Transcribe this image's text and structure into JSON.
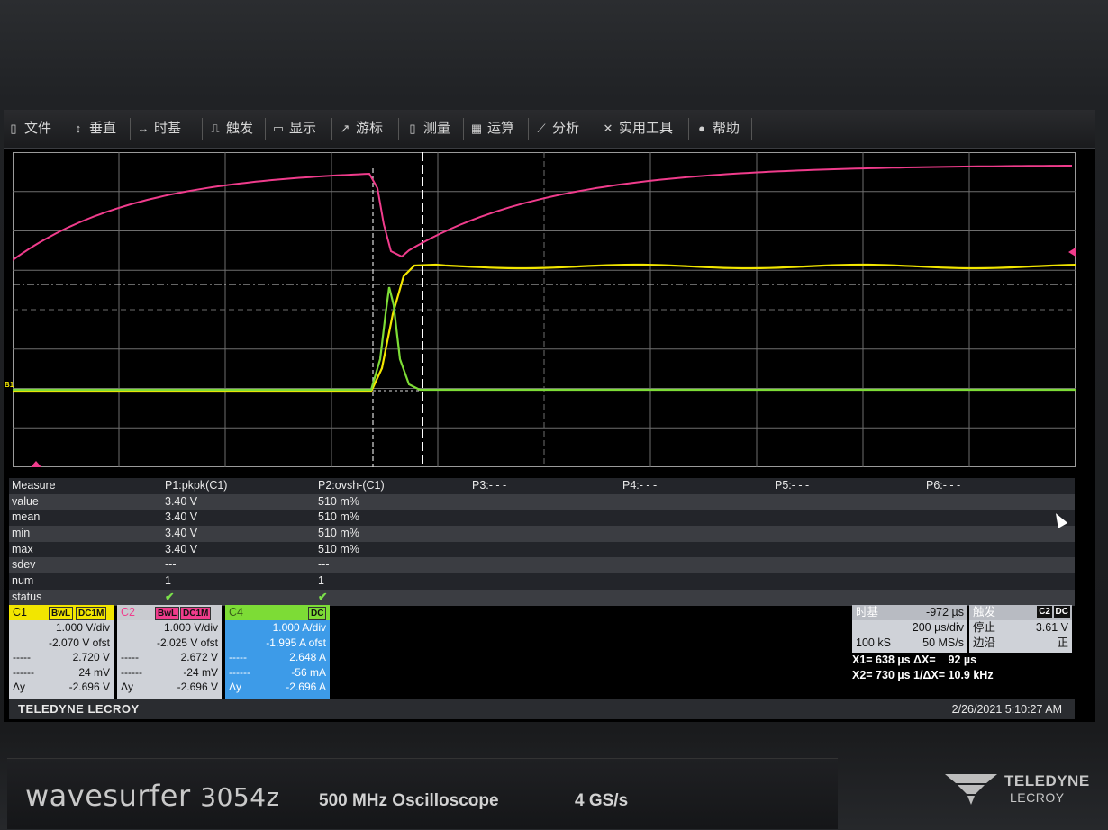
{
  "menu": [
    {
      "icon": "folder-icon",
      "glyph": "▯",
      "label": "文件"
    },
    {
      "icon": "vertical-icon",
      "glyph": "↕",
      "label": "垂直"
    },
    {
      "icon": "horizontal-icon",
      "glyph": "↔",
      "label": "时基"
    },
    {
      "icon": "trigger-icon",
      "glyph": "⎍",
      "label": "触发"
    },
    {
      "icon": "display-icon",
      "glyph": "▭",
      "label": "显示"
    },
    {
      "icon": "cursor-icon",
      "glyph": "↗",
      "label": "游标"
    },
    {
      "icon": "measure-icon",
      "glyph": "▯",
      "label": "测量"
    },
    {
      "icon": "math-icon",
      "glyph": "▦",
      "label": "运算"
    },
    {
      "icon": "analysis-icon",
      "glyph": "⟋",
      "label": "分析"
    },
    {
      "icon": "tools-icon",
      "glyph": "✕",
      "label": "实用工具"
    },
    {
      "icon": "help-icon",
      "glyph": "●",
      "label": "帮助"
    }
  ],
  "measure": {
    "header": {
      "label": "Measure",
      "p1": "P1:pkpk(C1)",
      "p2": "P2:ovsh-(C1)",
      "p3": "P3:- - -",
      "p4": "P4:- - -",
      "p5": "P5:- - -",
      "p6": "P6:- - -"
    },
    "rows": [
      {
        "label": "value",
        "p1": "3.40 V",
        "p2": "510 m%"
      },
      {
        "label": "mean",
        "p1": "3.40 V",
        "p2": "510 m%"
      },
      {
        "label": "min",
        "p1": "3.40 V",
        "p2": "510 m%"
      },
      {
        "label": "max",
        "p1": "3.40 V",
        "p2": "510 m%"
      },
      {
        "label": "sdev",
        "p1": "---",
        "p2": "---"
      },
      {
        "label": "num",
        "p1": "1",
        "p2": "1"
      },
      {
        "label": "status",
        "p1": "✔",
        "p2": "✔"
      }
    ]
  },
  "channels": [
    {
      "name": "C1",
      "color": "#f2e600",
      "tags": [
        "BwL",
        "DC1M"
      ],
      "vdiv": "1.000 V/div",
      "ofst": "-2.070 V ofst",
      "c1": "2.720 V",
      "c2": "24 mV",
      "dy_label": "Δy",
      "dy": "-2.696 V"
    },
    {
      "name": "C2",
      "color": "#f03c8c",
      "tags": [
        "BwL",
        "DC1M"
      ],
      "vdiv": "1.000 V/div",
      "ofst": "-2.025 V ofst",
      "c1": "2.672 V",
      "c2": "-24 mV",
      "dy_label": "Δy",
      "dy": "-2.696 V"
    },
    {
      "name": "C4",
      "color": "#7ddc36",
      "tags": [
        "DC"
      ],
      "vdiv": "1.000 A/div",
      "ofst": "-1.995 A ofst",
      "c1": "2.648 A",
      "c2": "-56 mA",
      "dy_label": "Δy",
      "dy": "-2.696 A"
    }
  ],
  "timebase": {
    "label": "时基",
    "delay": "-972 µs",
    "tdiv": "200 µs/div",
    "samples": "100 kS",
    "rate": "50 MS/s"
  },
  "trigger": {
    "label": "触发",
    "tags": [
      "C2",
      "DC"
    ],
    "mode": "停止",
    "level": "3.61 V",
    "edge_label": "边沿",
    "slope": "正"
  },
  "cursors": {
    "line1": "X1= 638 µs ΔX=    92 µs",
    "line2": "X2= 730 µs 1/ΔX= 10.9 kHz"
  },
  "status_bar": {
    "brand": "TELEDYNE LECROY",
    "datetime": "2/26/2021 5:10:27 AM"
  },
  "bezel": {
    "model_word": "wavesurfer",
    "model_num": "3054z",
    "description": "500 MHz Oscilloscope",
    "rate": "4 GS/s",
    "logo_line1": "TELEDYNE",
    "logo_line2": "LECROY"
  },
  "trace_colors": {
    "c1": "#f2e600",
    "c2": "#f03c8c",
    "c4": "#7ddc36"
  },
  "grid_label": "B1"
}
